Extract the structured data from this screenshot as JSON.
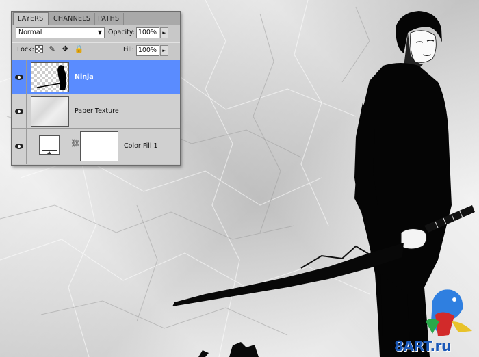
{
  "panel": {
    "tabs": [
      {
        "label": "LAYERS",
        "active": true
      },
      {
        "label": "CHANNELS",
        "active": false
      },
      {
        "label": "PATHS",
        "active": false
      }
    ],
    "blend_mode": "Normal",
    "opacity_label": "Opacity:",
    "opacity_value": "100%",
    "lock_label": "Lock:",
    "lock_icons": [
      "transparency-lock-icon",
      "brush-lock-icon",
      "move-lock-icon",
      "padlock-icon"
    ],
    "fill_label": "Fill:",
    "fill_value": "100%",
    "layers": [
      {
        "name": "Ninja",
        "selected": true,
        "visible": true,
        "thumbnail": "ninja-silhouette"
      },
      {
        "name": "Paper Texture",
        "selected": false,
        "visible": true,
        "thumbnail": "paper"
      },
      {
        "name": "Color Fill 1",
        "selected": false,
        "visible": true,
        "thumbnail": "fill-adjustment",
        "mask": "white"
      }
    ]
  },
  "watermark": {
    "text": "8ART.ru"
  },
  "colors": {
    "selection": "#5a8cff",
    "panel": "#c8c8c8",
    "watermark": "#1a58b8"
  }
}
